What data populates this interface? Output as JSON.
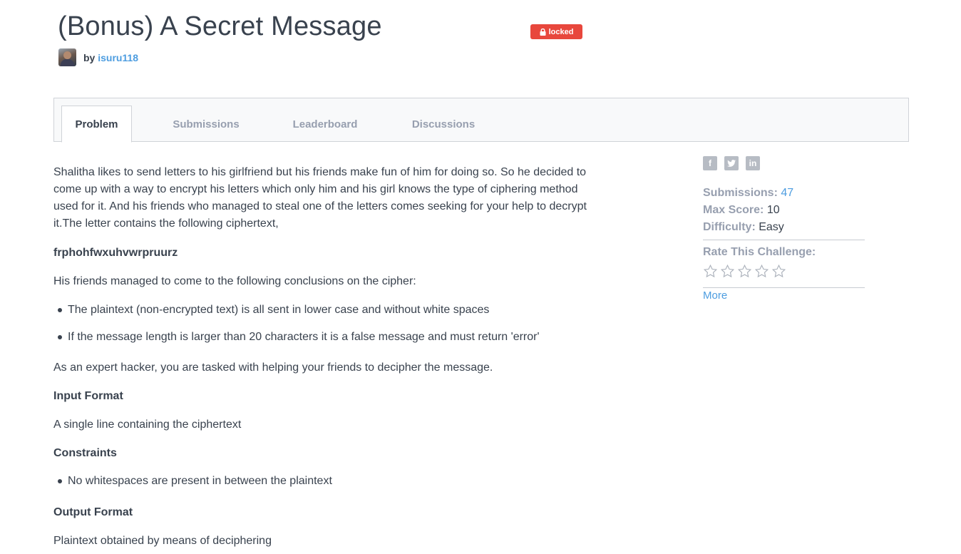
{
  "header": {
    "title": "(Bonus) A Secret Message",
    "badge": "locked",
    "by": "by",
    "author": "isuru118"
  },
  "tabs": [
    {
      "label": "Problem",
      "active": true
    },
    {
      "label": "Submissions",
      "active": false
    },
    {
      "label": "Leaderboard",
      "active": false
    },
    {
      "label": "Discussions",
      "active": false
    }
  ],
  "problem": {
    "intro_lines": [
      "Shalitha likes to send letters to his girlfriend but his friends make fun of him for doing so. So he decided to",
      "come up with a way to encrypt his letters which only him and his girl knows the type of ciphering method",
      "used for it. And his friends who managed to steal one of the letters comes seeking for your help to decrypt",
      "it.The letter contains the following ciphertext,"
    ],
    "ciphertext": "frphohfwxuhvwrpruurz",
    "conclusions_intro": "His friends managed to come to the following conclusions on the cipher:",
    "conclusions": [
      "The plaintext (non-encrypted text) is all sent in lower case and without white spaces",
      "If the message length is larger than 20 characters it is a false message and must return 'error'"
    ],
    "task": "As an expert hacker, you are tasked with helping your friends to decipher the message.",
    "input_heading": "Input Format",
    "input_text": "A single line containing the ciphertext",
    "constraints_heading": "Constraints",
    "constraints": [
      "No whitespaces are present in between the plaintext"
    ],
    "output_heading": "Output Format",
    "output_text": "Plaintext obtained by means of deciphering"
  },
  "sidebar": {
    "social_icons": [
      "facebook-icon",
      "twitter-icon",
      "linkedin-icon"
    ],
    "submissions_label": "Submissions:",
    "submissions_value": "47",
    "max_score_label": "Max Score:",
    "max_score_value": "10",
    "difficulty_label": "Difficulty:",
    "difficulty_value": "Easy",
    "rate_label": "Rate This Challenge:",
    "rating": 0,
    "stars_total": 5,
    "more_label": "More"
  },
  "colors": {
    "badge": "#e8473c",
    "link": "#4d9de0",
    "text": "#39424e",
    "muted": "#979faf"
  }
}
